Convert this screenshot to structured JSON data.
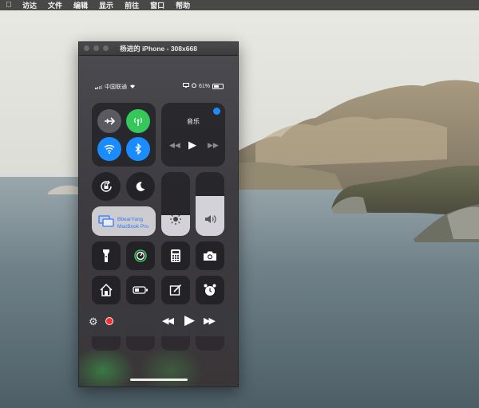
{
  "menubar": {
    "apple_icon": "apple-logo-icon",
    "items": [
      "访达",
      "文件",
      "编辑",
      "显示",
      "前往",
      "窗口",
      "帮助"
    ]
  },
  "window": {
    "title": "杨进的 iPhone - 308x668"
  },
  "status": {
    "carrier": "中国联通",
    "battery": "61%"
  },
  "control_center": {
    "connectivity": [
      "airplane-mode-icon",
      "cellular-data-icon",
      "wifi-icon",
      "bluetooth-icon"
    ],
    "music": {
      "title": "音乐",
      "controls": [
        "previous-icon",
        "play-icon",
        "next-icon"
      ]
    },
    "screen_mirroring": {
      "line1": "BbearYang",
      "line2": "MacBook Pro"
    },
    "brightness_level": 0.28,
    "volume_level": 0.62
  },
  "colors": {
    "accent_green": "#35c759",
    "accent_blue": "#1a8cff",
    "record_red": "#ff2d2d"
  }
}
